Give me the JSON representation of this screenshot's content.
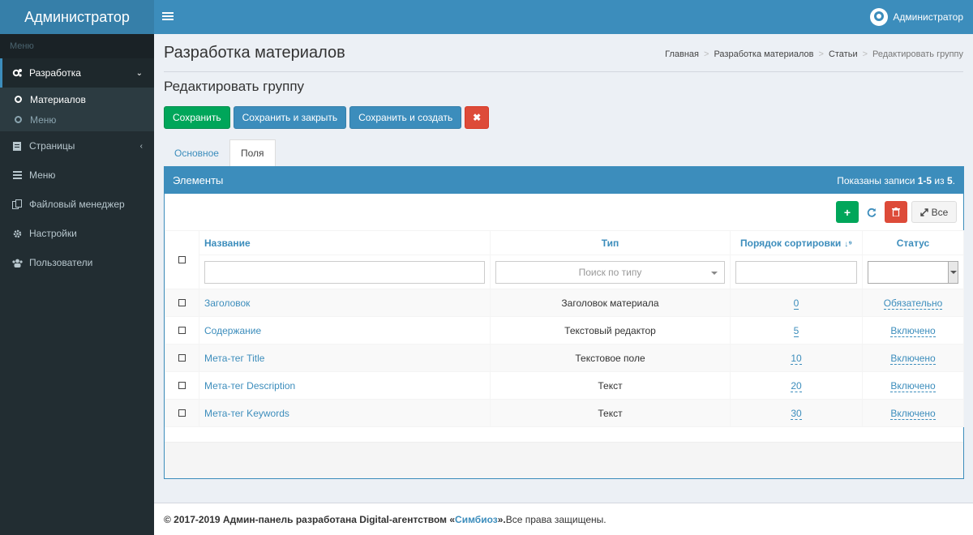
{
  "app": {
    "logo": "Администратор",
    "user_name": "Администратор"
  },
  "sidebar": {
    "header": "Меню",
    "items": [
      {
        "label": "Разработка",
        "icon": "cogs-icon",
        "arrow": "⌄",
        "active": true
      },
      {
        "label": "Страницы",
        "icon": "file-icon",
        "arrow": "‹"
      },
      {
        "label": "Меню",
        "icon": "bars-icon"
      },
      {
        "label": "Файловый менеджер",
        "icon": "files-icon"
      },
      {
        "label": "Настройки",
        "icon": "gear-icon"
      },
      {
        "label": "Пользователи",
        "icon": "users-icon"
      }
    ],
    "sub_items": [
      {
        "label": "Материалов",
        "active": true
      },
      {
        "label": "Меню"
      }
    ]
  },
  "page": {
    "title": "Разработка материалов",
    "subtitle": "Редактировать группу",
    "breadcrumb": [
      "Главная",
      "Разработка материалов",
      "Статьи",
      "Редактировать группу"
    ]
  },
  "buttons": {
    "save": "Сохранить",
    "save_close": "Сохранить и закрыть",
    "save_create": "Сохранить и создать",
    "cancel": "✖"
  },
  "tabs": [
    "Основное",
    "Поля"
  ],
  "panel": {
    "title": "Элементы",
    "summary_prefix": "Показаны записи ",
    "summary_range": "1-5",
    "summary_mid": " из ",
    "summary_total": "5",
    "summary_end": ".",
    "all_label": "Все"
  },
  "table": {
    "columns": [
      "Название",
      "Тип",
      "Порядок сортировки",
      "Статус"
    ],
    "type_filter_placeholder": "Поиск по типу",
    "rows": [
      {
        "name": "Заголовок",
        "type": "Заголовок материала",
        "order": "0",
        "status": "Обязательно"
      },
      {
        "name": "Содержание",
        "type": "Текстовый редактор",
        "order": "5",
        "status": "Включено"
      },
      {
        "name": "Мета-тег Title",
        "type": "Текстовое поле",
        "order": "10",
        "status": "Включено"
      },
      {
        "name": "Мета-тег Description",
        "type": "Текст",
        "order": "20",
        "status": "Включено"
      },
      {
        "name": "Мета-тег Keywords",
        "type": "Текст",
        "order": "30",
        "status": "Включено"
      }
    ]
  },
  "footer": {
    "text_before": "© 2017-2019 Админ-панель разработана Digital-агентством «",
    "brand": "Симбиоз",
    "text_mid": "».",
    "text_after": " Все права защищены."
  },
  "colors": {
    "primary": "#3c8dbc",
    "success": "#00a65a",
    "danger": "#dd4b39",
    "sidebar": "#222d32"
  }
}
